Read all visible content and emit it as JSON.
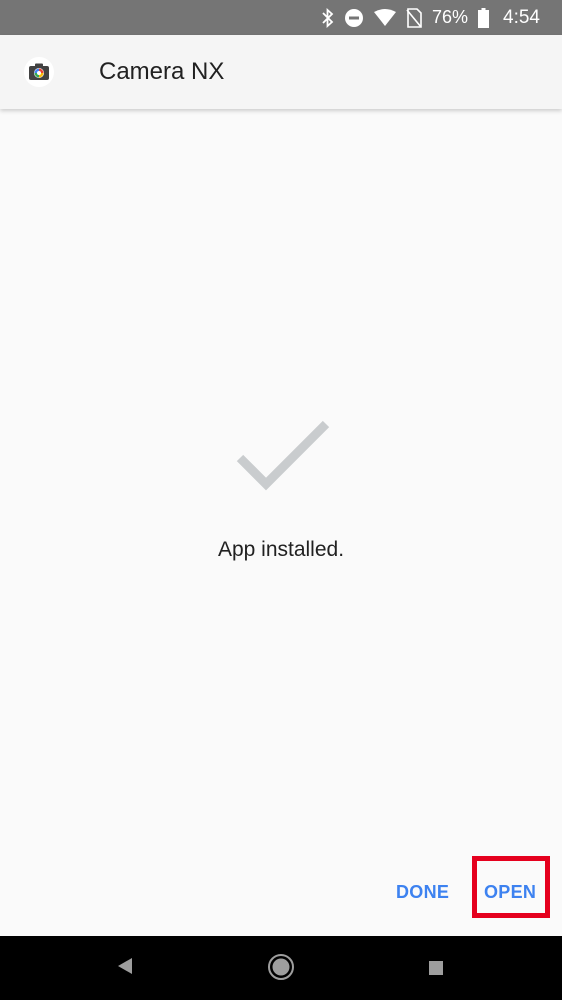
{
  "status_bar": {
    "battery_percent": "76%",
    "time": "4:54",
    "icons": [
      "bluetooth-icon",
      "do-not-disturb-icon",
      "wifi-icon",
      "no-sim-icon",
      "battery-icon"
    ]
  },
  "app_bar": {
    "title": "Camera NX",
    "icon": "camera-app-icon"
  },
  "main": {
    "status_icon": "checkmark-icon",
    "message": "App installed."
  },
  "actions": {
    "done_label": "DONE",
    "open_label": "OPEN"
  },
  "nav_bar": {
    "icons": [
      "back-icon",
      "home-icon",
      "recents-icon"
    ]
  },
  "colors": {
    "status_bar": "#757575",
    "accent": "#3d82f0",
    "highlight": "#e5001e",
    "check": "#c9ccce"
  }
}
